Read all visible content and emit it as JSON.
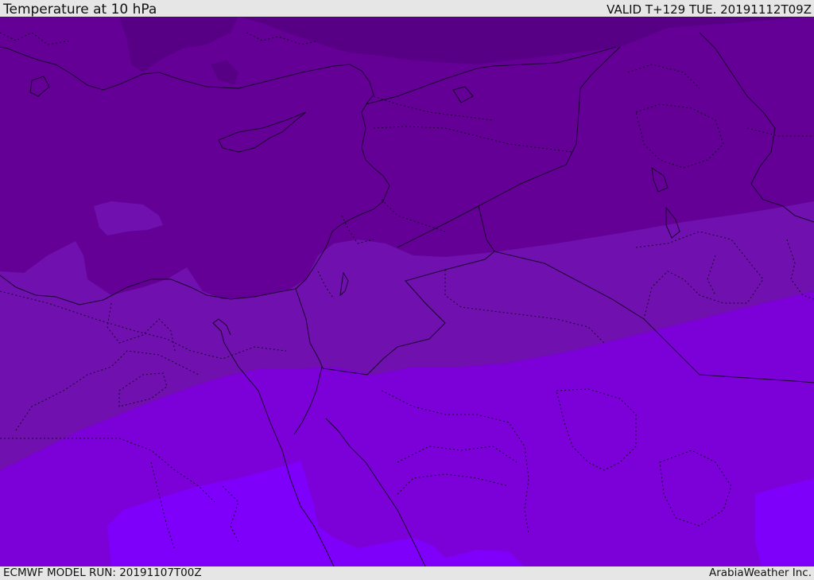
{
  "header": {
    "title": "Temperature at 10 hPa",
    "valid_time": "VALID T+129 TUE. 20191112T09Z"
  },
  "footer": {
    "model_run": "ECMWF MODEL RUN: 20191107T00Z",
    "credit": "ArabiaWeather Inc."
  },
  "map": {
    "bands": [
      {
        "name": "darkest",
        "color": "#570086"
      },
      {
        "name": "dark",
        "color": "#650096"
      },
      {
        "name": "mid",
        "color": "#7010ae"
      },
      {
        "name": "bright",
        "color": "#7c00d8"
      },
      {
        "name": "brightest",
        "color": "#7e00fa"
      }
    ],
    "coast_color": "#1a0030",
    "border_color": "#1a0030"
  }
}
